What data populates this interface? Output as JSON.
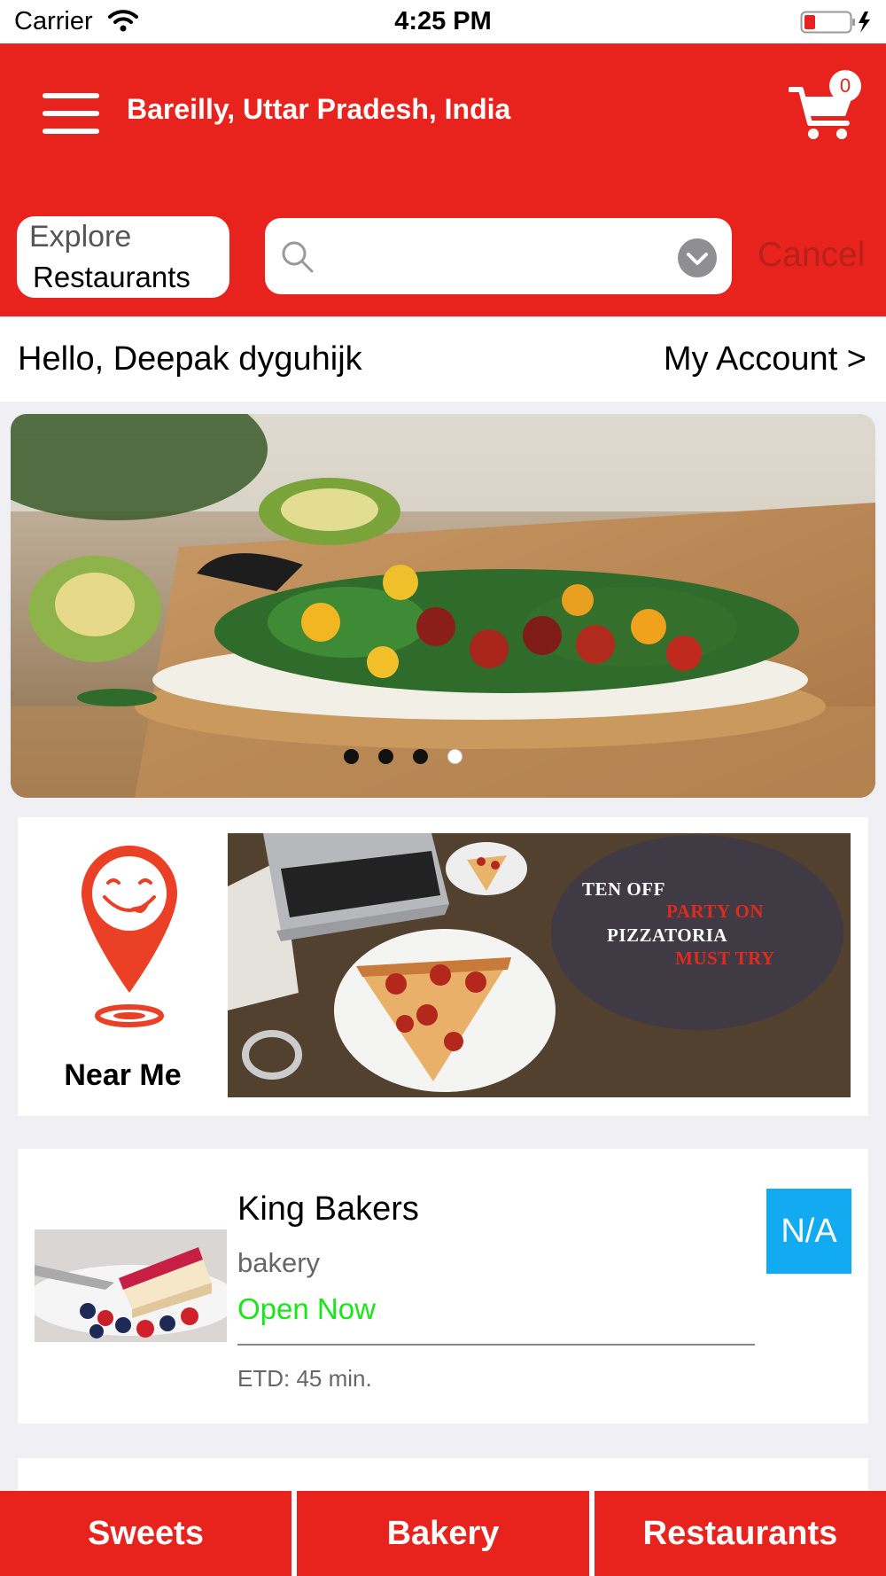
{
  "status_bar": {
    "carrier": "Carrier",
    "time": "4:25 PM"
  },
  "header": {
    "location": "Bareilly, Uttar Pradesh, India",
    "cart_count": "0",
    "explore_line1": "Explore",
    "explore_line2": "Restaurants",
    "search_value": "",
    "cancel_label": "Cancel"
  },
  "greeting": {
    "text": "Hello, Deepak dyguhijk",
    "account_label": "My Account >"
  },
  "carousel": {
    "slide_count": 4,
    "active_index": 3
  },
  "promo": {
    "near_me_label": "Near Me",
    "lines": [
      "TEN OFF",
      "PARTY ON",
      "PIZZATORIA",
      "MUST TRY"
    ]
  },
  "restaurant": {
    "name": "King Bakers",
    "category": "bakery",
    "status": "Open Now",
    "etd": "ETD: 45 min.",
    "rating_badge": "N/A"
  },
  "tabs": {
    "sweets": "Sweets",
    "bakery": "Bakery",
    "restaurants": "Restaurants"
  },
  "colors": {
    "brand_red": "#e8231d",
    "open_green": "#19e619",
    "badge_blue": "#12aaf0"
  }
}
